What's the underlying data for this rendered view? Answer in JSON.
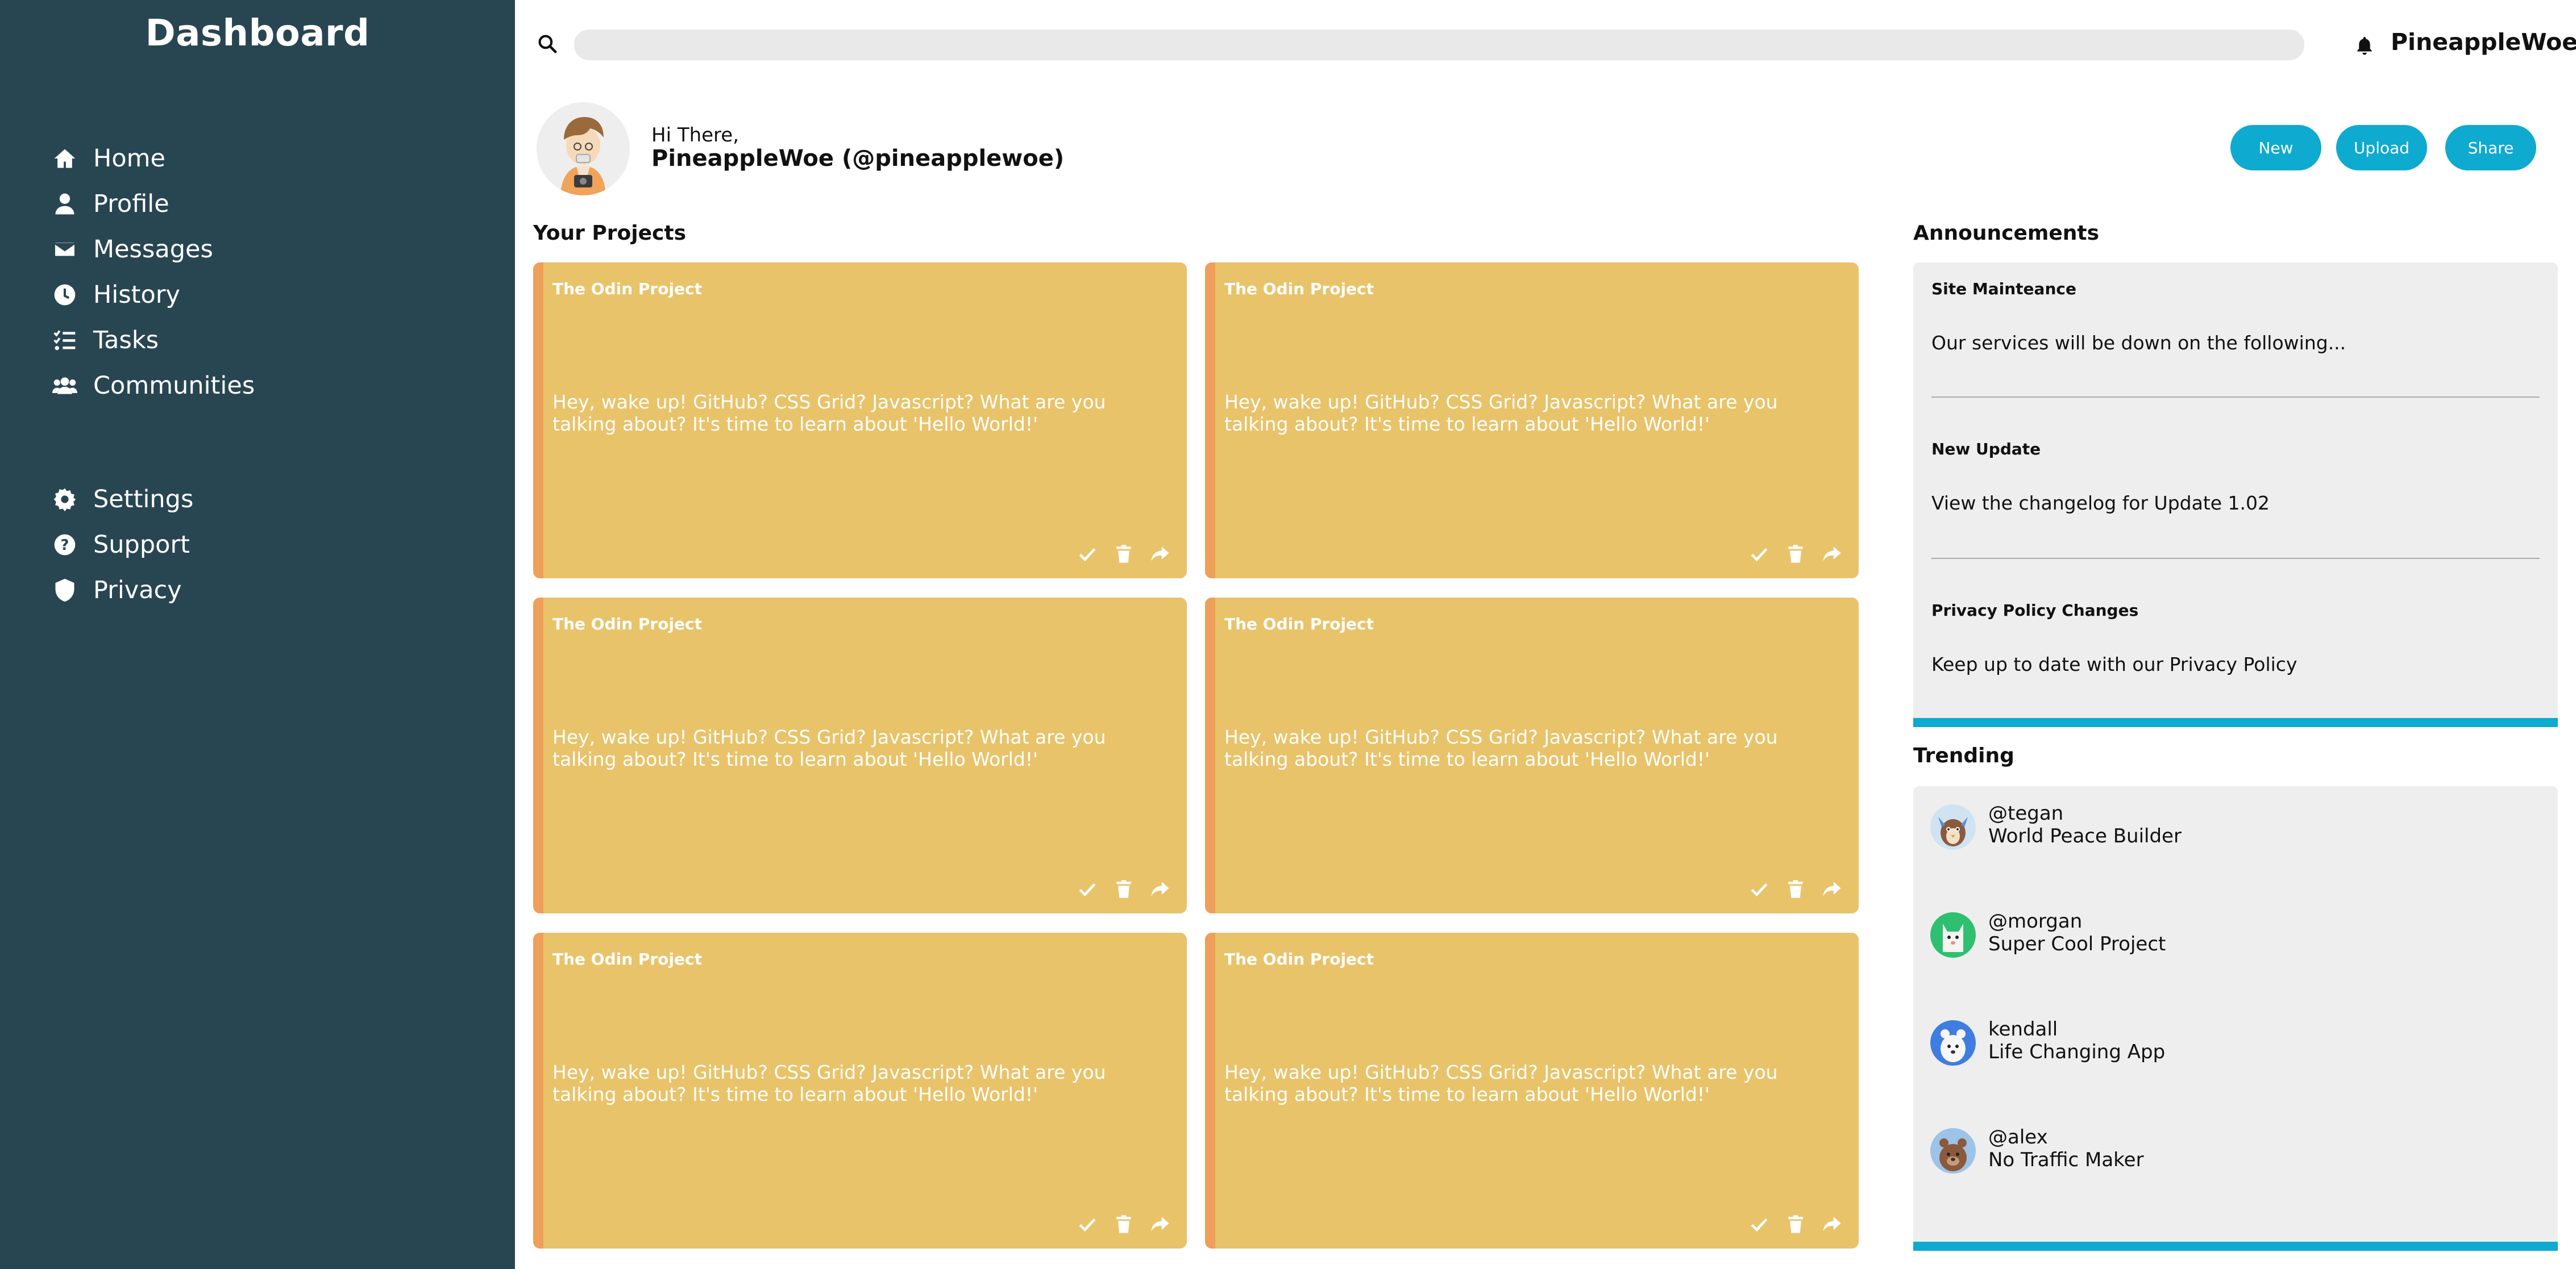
{
  "sidebar": {
    "title": "Dashboard",
    "items": [
      {
        "label": "Home",
        "icon": "home-icon"
      },
      {
        "label": "Profile",
        "icon": "user-icon"
      },
      {
        "label": "Messages",
        "icon": "envelope-icon"
      },
      {
        "label": "History",
        "icon": "clock-icon"
      },
      {
        "label": "Tasks",
        "icon": "tasks-icon"
      },
      {
        "label": "Communities",
        "icon": "users-icon"
      }
    ],
    "secondary_items": [
      {
        "label": "Settings",
        "icon": "gear-icon"
      },
      {
        "label": "Support",
        "icon": "question-icon"
      },
      {
        "label": "Privacy",
        "icon": "shield-icon"
      }
    ]
  },
  "header": {
    "search_placeholder": "",
    "username": "PineappleWoe"
  },
  "greeting": {
    "hi": "Hi There,",
    "name": "PineappleWoe (@pineapplewoe)"
  },
  "actions": {
    "new": "New",
    "upload": "Upload",
    "share": "Share"
  },
  "projects": {
    "title": "Your Projects",
    "cards": [
      {
        "title": "The Odin Project",
        "description": "Hey, wake up! GitHub? CSS Grid? Javascript? What are you talking about? It's time to learn about 'Hello World!'"
      },
      {
        "title": "The Odin Project",
        "description": "Hey, wake up! GitHub? CSS Grid? Javascript? What are you talking about? It's time to learn about 'Hello World!'"
      },
      {
        "title": "The Odin Project",
        "description": "Hey, wake up! GitHub? CSS Grid? Javascript? What are you talking about? It's time to learn about 'Hello World!'"
      },
      {
        "title": "The Odin Project",
        "description": "Hey, wake up! GitHub? CSS Grid? Javascript? What are you talking about? It's time to learn about 'Hello World!'"
      },
      {
        "title": "The Odin Project",
        "description": "Hey, wake up! GitHub? CSS Grid? Javascript? What are you talking about? It's time to learn about 'Hello World!'"
      },
      {
        "title": "The Odin Project",
        "description": "Hey, wake up! GitHub? CSS Grid? Javascript? What are you talking about? It's time to learn about 'Hello World!'"
      }
    ]
  },
  "announcements": {
    "title": "Announcements",
    "items": [
      {
        "title": "Site Mainteance",
        "body": "Our services will be down on the following..."
      },
      {
        "title": "New Update",
        "body": "View the changelog for Update 1.02"
      },
      {
        "title": "Privacy Policy Changes",
        "body": "Keep up to date with our Privacy Policy"
      }
    ]
  },
  "trending": {
    "title": "Trending",
    "items": [
      {
        "handle": "@tegan",
        "project": "World Peace Builder"
      },
      {
        "handle": "@morgan",
        "project": "Super Cool Project"
      },
      {
        "handle": "kendall",
        "project": "Life Changing App"
      },
      {
        "handle": "@alex",
        "project": "No Traffic Maker"
      }
    ]
  },
  "colors": {
    "sidebar": "#284552",
    "accent": "#0eaad0",
    "card": "#e8c36a",
    "card_border": "#ee9f5a",
    "panel": "#eeeeee"
  }
}
